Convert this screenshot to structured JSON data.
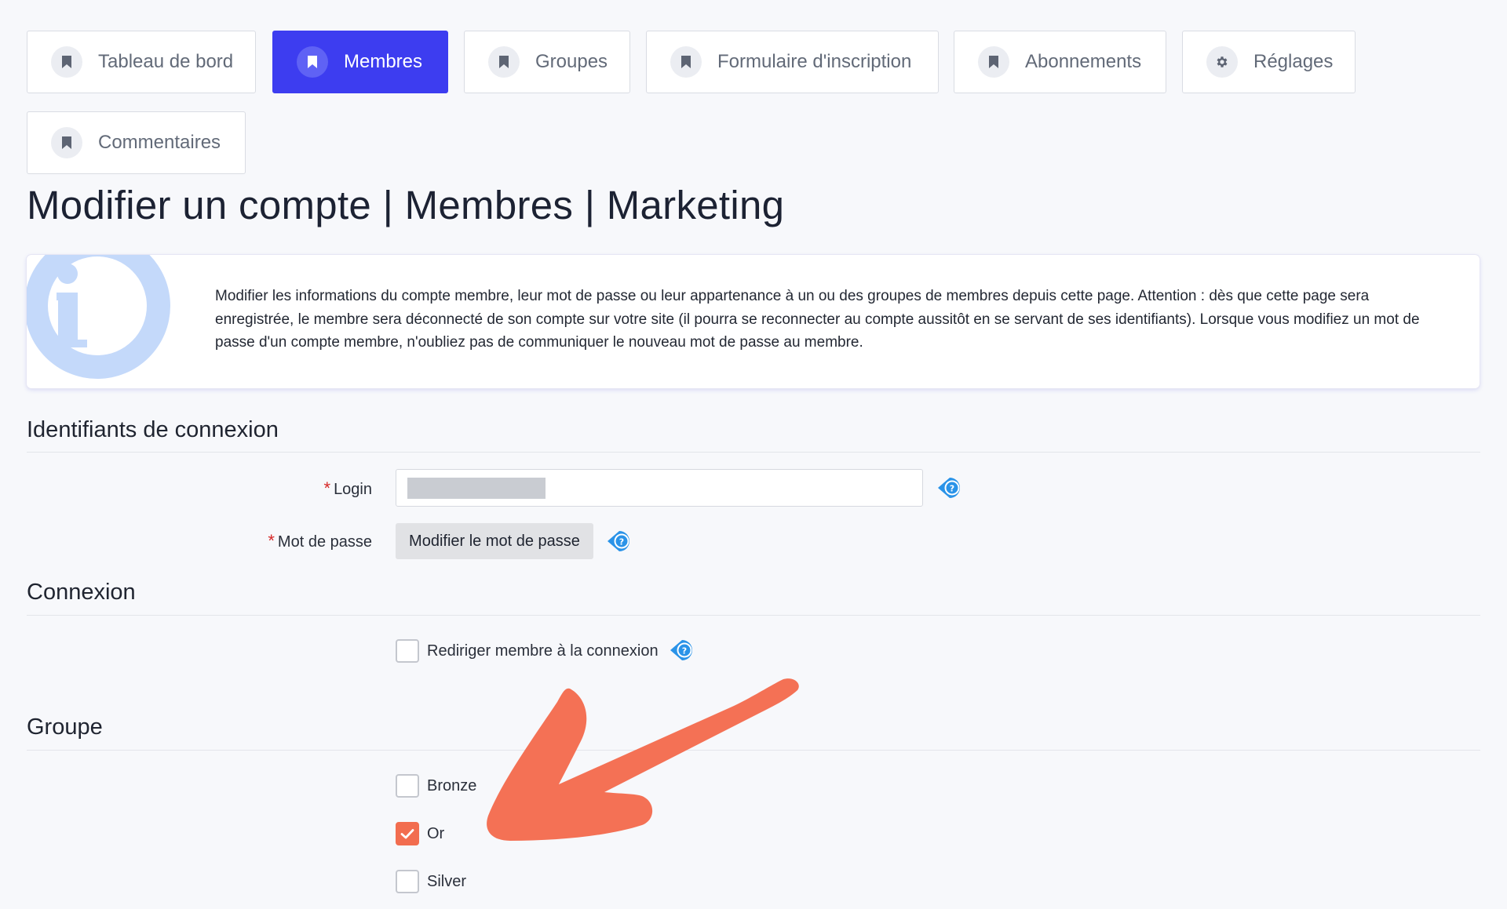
{
  "tabs": [
    {
      "label": "Tableau de bord",
      "icon": "bookmark-icon",
      "active": false
    },
    {
      "label": "Membres",
      "icon": "bookmark-icon",
      "active": true
    },
    {
      "label": "Groupes",
      "icon": "bookmark-icon",
      "active": false
    },
    {
      "label": "Formulaire d'inscription",
      "icon": "bookmark-icon",
      "active": false
    },
    {
      "label": "Abonnements",
      "icon": "bookmark-icon",
      "active": false
    },
    {
      "label": "Réglages",
      "icon": "gear-icon",
      "active": false
    },
    {
      "label": "Commentaires",
      "icon": "bookmark-icon",
      "active": false
    }
  ],
  "page": {
    "title": "Modifier un compte | Membres | Marketing"
  },
  "info": {
    "text": "Modifier les informations du compte membre, leur mot de passe ou leur appartenance à un ou des groupes de membres depuis cette page. Attention : dès que cette page sera enregistrée, le membre sera déconnecté de son compte sur votre site (il pourra se reconnecter au compte aussitôt en se servant de ses identifiants). Lorsque vous modifiez un mot de passe d'un compte membre, n'oubliez pas de communiquer le nouveau mot de passe au membre."
  },
  "sections": {
    "credentials": {
      "title": "Identifiants de connexion",
      "login_label": "Login",
      "login_value": "",
      "password_label": "Mot de passe",
      "password_button": "Modifier le mot de passe",
      "required_mark": "*"
    },
    "connection": {
      "title": "Connexion",
      "redirect_label": "Rediriger membre à la connexion",
      "redirect_checked": false
    },
    "group": {
      "title": "Groupe",
      "options": [
        {
          "label": "Bronze",
          "checked": false
        },
        {
          "label": "Or",
          "checked": true
        },
        {
          "label": "Silver",
          "checked": false
        }
      ]
    }
  },
  "colors": {
    "accent": "#3d3df0",
    "checkbox_checked": "#f26d4f",
    "annotation_arrow": "#f47155",
    "help_icon": "#2a93e8",
    "required": "#d62828"
  }
}
